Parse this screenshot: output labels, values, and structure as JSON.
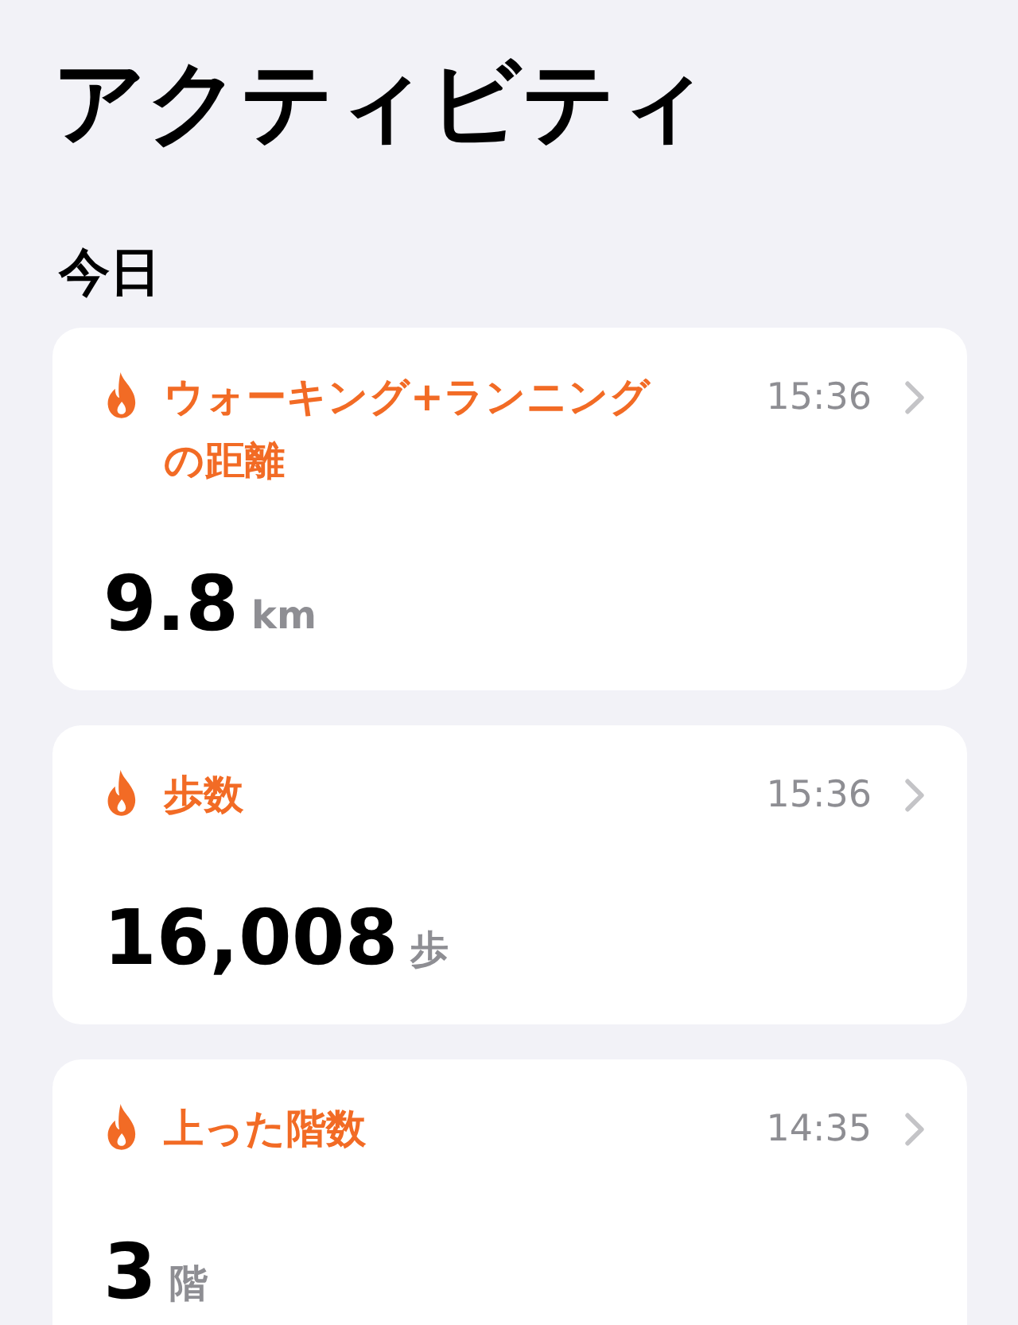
{
  "title": "アクティビティ",
  "section": "今日",
  "cards": [
    {
      "title": "ウォーキング+ランニングの距離",
      "time": "15:36",
      "value": "9.8",
      "unit": "km"
    },
    {
      "title": "歩数",
      "time": "15:36",
      "value": "16,008",
      "unit": "歩"
    },
    {
      "title": "上った階数",
      "time": "14:35",
      "value": "3",
      "unit": "階"
    }
  ]
}
